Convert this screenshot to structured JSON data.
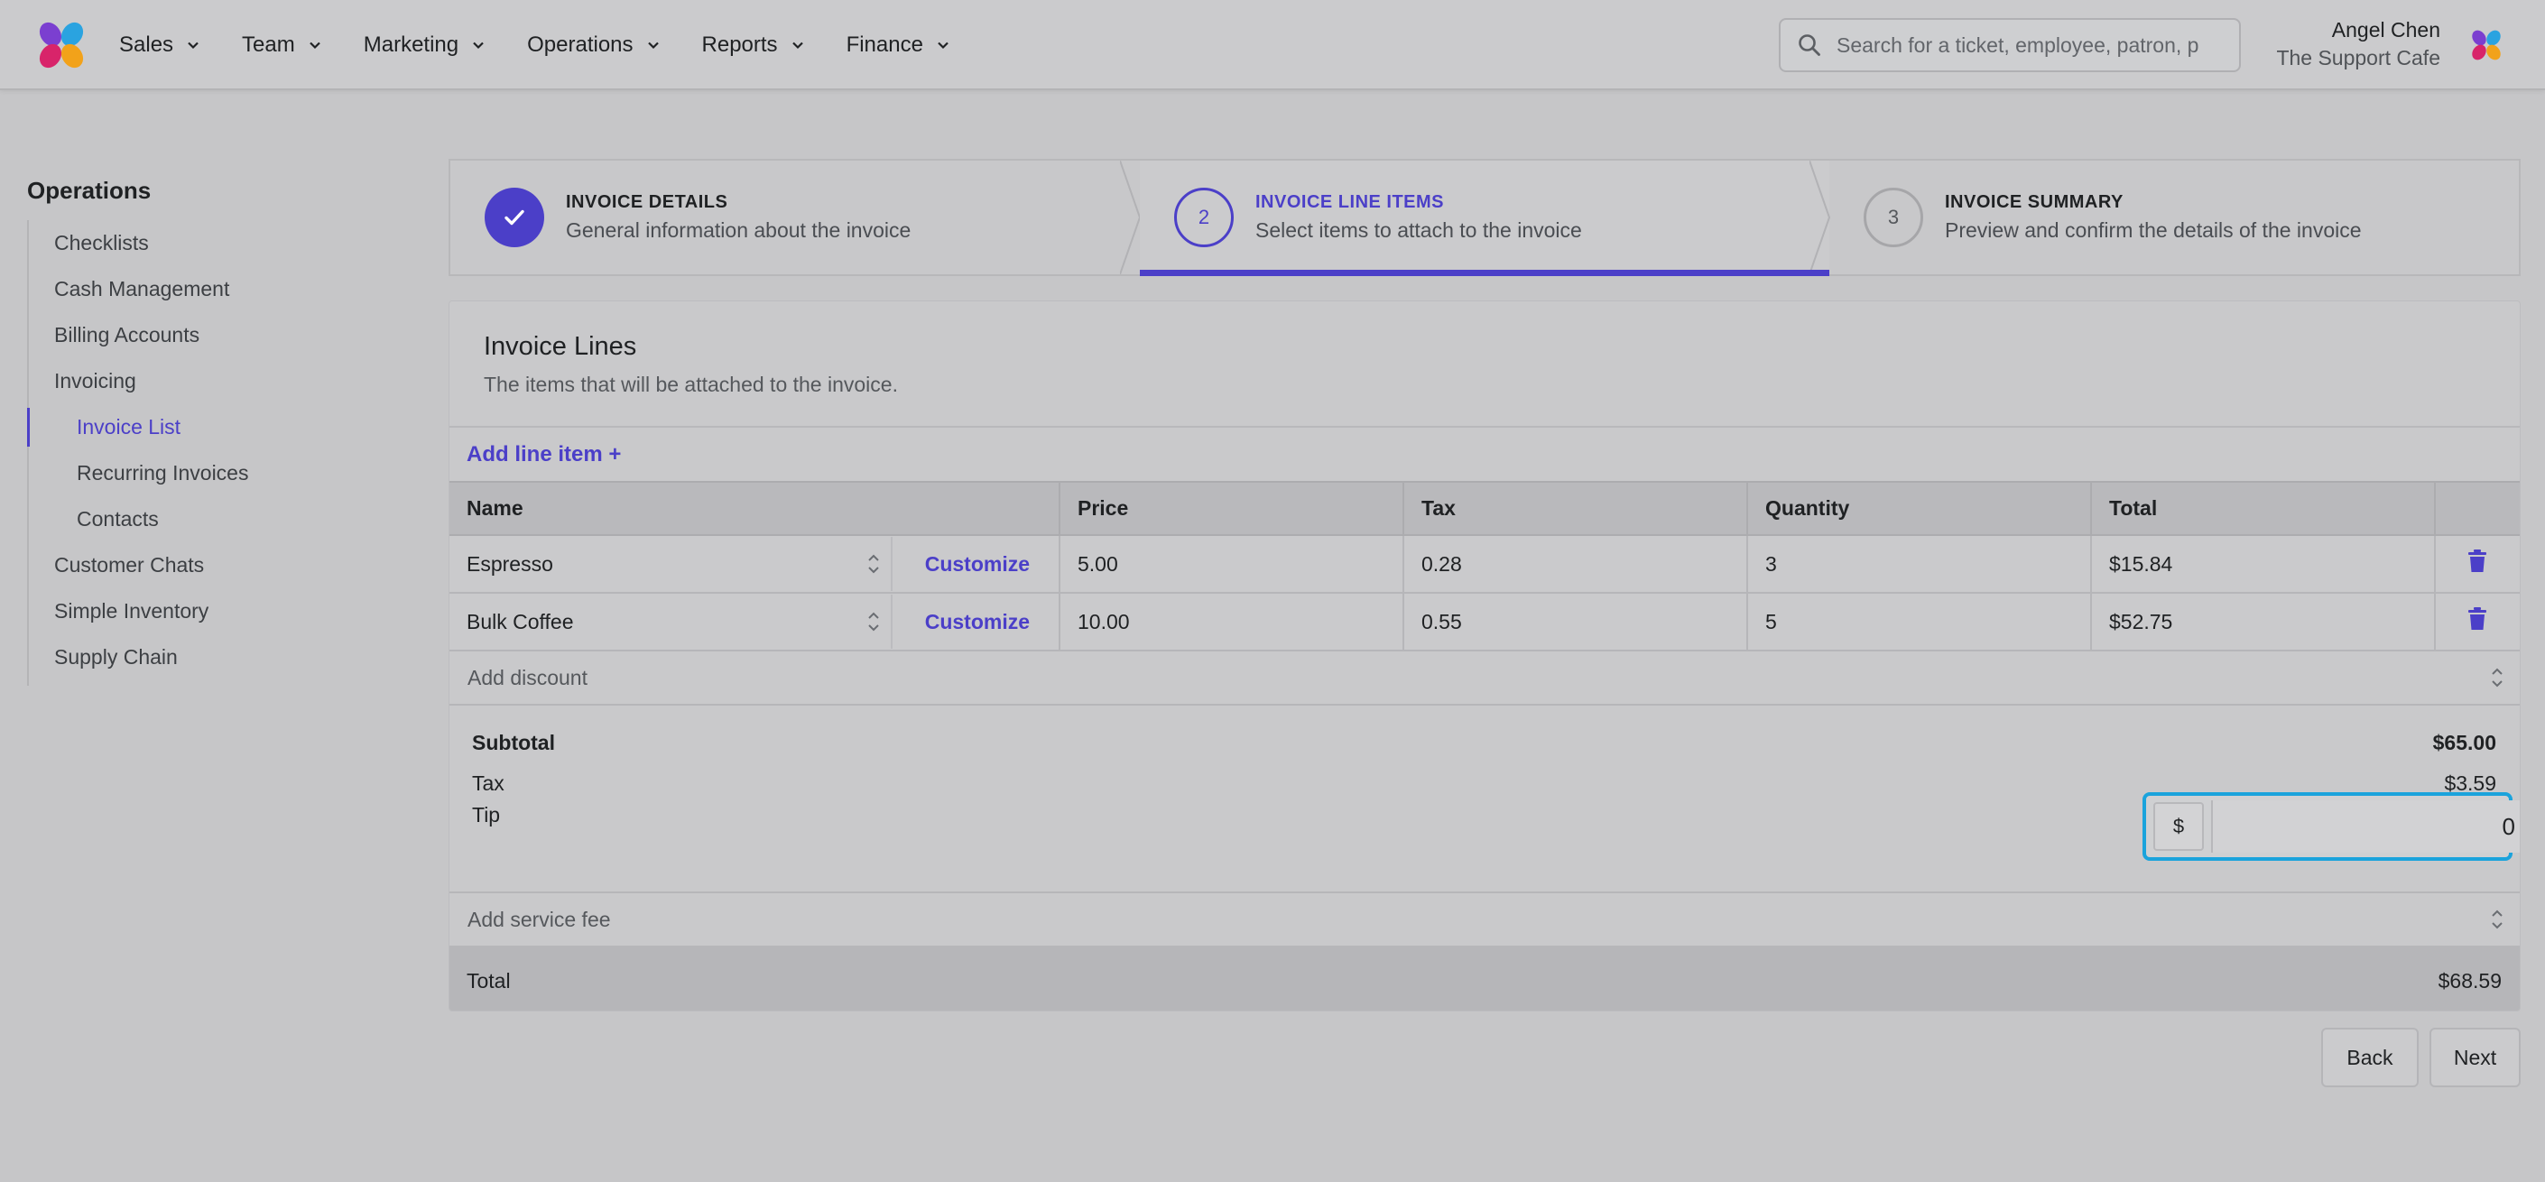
{
  "header": {
    "nav": [
      {
        "label": "Sales"
      },
      {
        "label": "Team"
      },
      {
        "label": "Marketing"
      },
      {
        "label": "Operations"
      },
      {
        "label": "Reports"
      },
      {
        "label": "Finance"
      }
    ],
    "search_placeholder": "Search for a ticket, employee, patron, p",
    "user_name": "Angel Chen",
    "user_org": "The Support Cafe"
  },
  "sidebar": {
    "title": "Operations",
    "items": [
      {
        "label": "Checklists"
      },
      {
        "label": "Cash Management"
      },
      {
        "label": "Billing Accounts"
      },
      {
        "label": "Invoicing"
      },
      {
        "label": "Invoice List"
      },
      {
        "label": "Recurring Invoices"
      },
      {
        "label": "Contacts"
      },
      {
        "label": "Customer Chats"
      },
      {
        "label": "Simple Inventory"
      },
      {
        "label": "Supply Chain"
      }
    ]
  },
  "steps": [
    {
      "number": "1",
      "name": "INVOICE DETAILS",
      "desc": "General information about the invoice",
      "state": "complete"
    },
    {
      "number": "2",
      "name": "INVOICE LINE ITEMS",
      "desc": "Select items to attach to the invoice",
      "state": "current"
    },
    {
      "number": "3",
      "name": "INVOICE SUMMARY",
      "desc": "Preview and confirm the details of the invoice",
      "state": "upcoming"
    }
  ],
  "card": {
    "title": "Invoice Lines",
    "subtitle": "The items that will be attached to the invoice.",
    "add_line_label": "Add line item +"
  },
  "table": {
    "columns": [
      "Name",
      "Price",
      "Tax",
      "Quantity",
      "Total"
    ],
    "customize_label": "Customize",
    "rows": [
      {
        "name": "Espresso",
        "price": "5.00",
        "tax": "0.28",
        "quantity": "3",
        "total": "$15.84"
      },
      {
        "name": "Bulk Coffee",
        "price": "10.00",
        "tax": "0.55",
        "quantity": "5",
        "total": "$52.75"
      }
    ]
  },
  "add_discount_label": "Add discount",
  "totals": {
    "subtotal_label": "Subtotal",
    "subtotal_value": "$65.00",
    "tax_label": "Tax",
    "tax_value": "$3.59",
    "tip_label": "Tip",
    "tip_prefix": "$",
    "tip_value": "0"
  },
  "add_service_fee_label": "Add service fee",
  "grand_total": {
    "label": "Total",
    "value": "$68.59"
  },
  "buttons": {
    "back": "Back",
    "next": "Next"
  },
  "colors": {
    "accent": "#4b3fc8",
    "focus_ring": "#1aa3dc"
  }
}
